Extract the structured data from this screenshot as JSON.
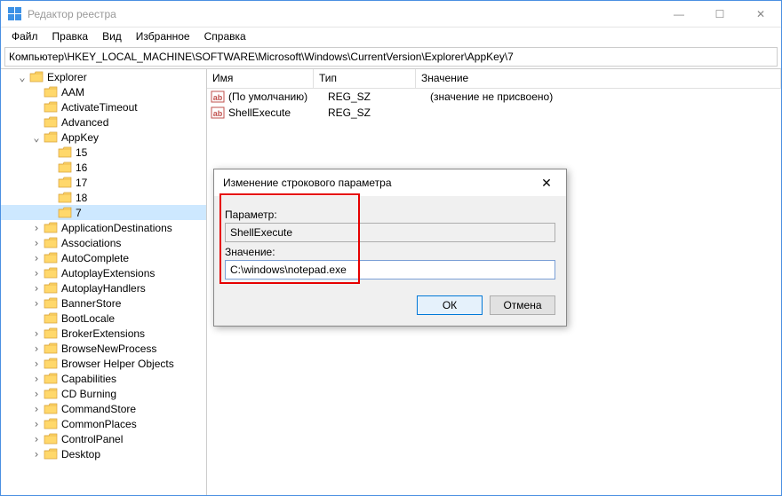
{
  "window": {
    "title": "Редактор реестра"
  },
  "winbtns": {
    "min": "—",
    "max": "☐",
    "close": "✕"
  },
  "menu": [
    "Файл",
    "Правка",
    "Вид",
    "Избранное",
    "Справка"
  ],
  "address": "Компьютер\\HKEY_LOCAL_MACHINE\\SOFTWARE\\Microsoft\\Windows\\CurrentVersion\\Explorer\\AppKey\\7",
  "list": {
    "headers": {
      "name": "Имя",
      "type": "Тип",
      "value": "Значение"
    },
    "rows": [
      {
        "name": "(По умолчанию)",
        "type": "REG_SZ",
        "value": "(значение не присвоено)"
      },
      {
        "name": "ShellExecute",
        "type": "REG_SZ",
        "value": ""
      }
    ]
  },
  "tree": [
    {
      "d": 1,
      "t": "open",
      "label": "Explorer"
    },
    {
      "d": 2,
      "t": "leaf",
      "label": "AAM"
    },
    {
      "d": 2,
      "t": "leaf",
      "label": "ActivateTimeout"
    },
    {
      "d": 2,
      "t": "leaf",
      "label": "Advanced"
    },
    {
      "d": 2,
      "t": "open",
      "label": "AppKey"
    },
    {
      "d": 3,
      "t": "leaf",
      "label": "15"
    },
    {
      "d": 3,
      "t": "leaf",
      "label": "16"
    },
    {
      "d": 3,
      "t": "leaf",
      "label": "17"
    },
    {
      "d": 3,
      "t": "leaf",
      "label": "18"
    },
    {
      "d": 3,
      "t": "leaf",
      "label": "7",
      "sel": true
    },
    {
      "d": 2,
      "t": "closed",
      "label": "ApplicationDestinations"
    },
    {
      "d": 2,
      "t": "closed",
      "label": "Associations"
    },
    {
      "d": 2,
      "t": "closed",
      "label": "AutoComplete"
    },
    {
      "d": 2,
      "t": "closed",
      "label": "AutoplayExtensions"
    },
    {
      "d": 2,
      "t": "closed",
      "label": "AutoplayHandlers"
    },
    {
      "d": 2,
      "t": "closed",
      "label": "BannerStore"
    },
    {
      "d": 2,
      "t": "leaf",
      "label": "BootLocale"
    },
    {
      "d": 2,
      "t": "closed",
      "label": "BrokerExtensions"
    },
    {
      "d": 2,
      "t": "closed",
      "label": "BrowseNewProcess"
    },
    {
      "d": 2,
      "t": "closed",
      "label": "Browser Helper Objects"
    },
    {
      "d": 2,
      "t": "closed",
      "label": "Capabilities"
    },
    {
      "d": 2,
      "t": "closed",
      "label": "CD Burning"
    },
    {
      "d": 2,
      "t": "closed",
      "label": "CommandStore"
    },
    {
      "d": 2,
      "t": "closed",
      "label": "CommonPlaces"
    },
    {
      "d": 2,
      "t": "closed",
      "label": "ControlPanel"
    },
    {
      "d": 2,
      "t": "closed",
      "label": "Desktop"
    }
  ],
  "dialog": {
    "title": "Изменение строкового параметра",
    "param_label": "Параметр:",
    "param_value": "ShellExecute",
    "value_label": "Значение:",
    "value_value": "C:\\windows\\notepad.exe",
    "ok": "ОК",
    "cancel": "Отмена",
    "close": "✕"
  }
}
